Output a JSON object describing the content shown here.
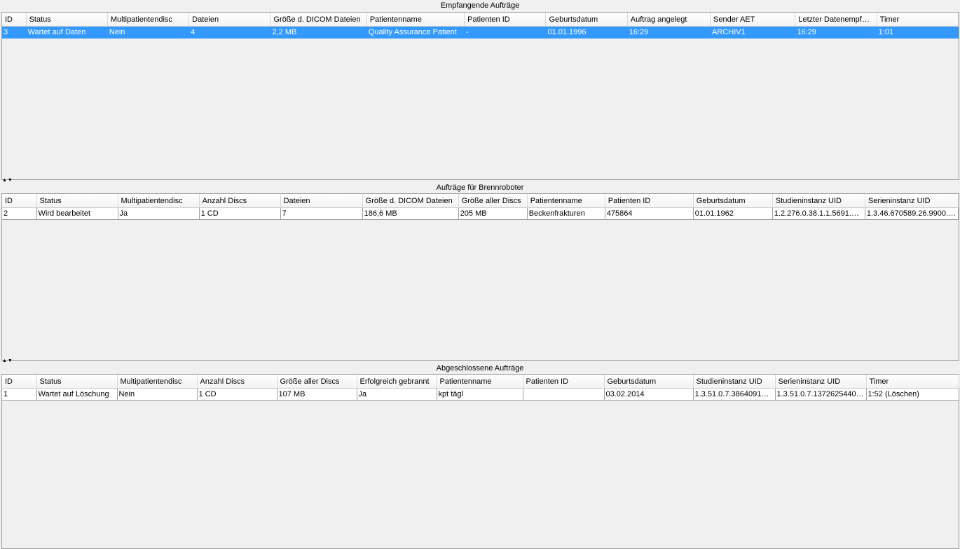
{
  "panels": [
    {
      "title": "Empfangende Aufträge",
      "columns": [
        "ID",
        "Status",
        "Multipatientendisc",
        "Dateien",
        "Größe d. DICOM Dateien",
        "Patientenname",
        "Patienten ID",
        "Geburtsdatum",
        "Auftrag angelegt",
        "Sender AET",
        "Letzter Datenempf…",
        "Timer"
      ],
      "rows": [
        [
          "3",
          "Wartet auf Daten",
          "Nein",
          "4",
          "2,2 MB",
          "Quality Assurance Patient",
          "-",
          "01.01.1996",
          "16:29",
          "ARCHIV1",
          "16:29",
          "1:01"
        ]
      ]
    },
    {
      "title": "Aufträge für Brennroboter",
      "columns": [
        "ID",
        "Status",
        "Multipatientendisc",
        "Anzahl Discs",
        "Dateien",
        "Größe d. DICOM Dateien",
        "Größe aller Discs",
        "Patientenname",
        "Patienten ID",
        "Geburtsdatum",
        "Studieninstanz UID",
        "Serieninstanz UID"
      ],
      "rows": [
        [
          "2",
          "Wird bearbeitet",
          "Ja",
          "1 CD",
          "7",
          "186,6 MB",
          "205 MB",
          "Beckenfrakturen",
          "475864",
          "01.01.1962",
          "1.2.276.0.38.1.1.5691.…",
          "1.3.46.670589.26.9900.…"
        ]
      ]
    },
    {
      "title": "Abgeschlossene Aufträge",
      "columns": [
        "ID",
        "Status",
        "Multipatientendisc",
        "Anzahl Discs",
        "Größe aller Discs",
        "Erfolgreich gebrannt",
        "Patientenname",
        "Patienten ID",
        "Geburtsdatum",
        "Studieninstanz UID",
        "Serieninstanz UID",
        "Timer"
      ],
      "rows": [
        [
          "1",
          "Wartet auf Löschung",
          "Nein",
          "1 CD",
          "107 MB",
          "Ja",
          "kpt tägl",
          "",
          "03.02.2014",
          "1.3.51.0.7.3864091…",
          "1.3.51.0.7.1372625440…",
          "1:52 (Löschen)"
        ]
      ]
    }
  ],
  "splitter_arrows": "▲▼",
  "colors": {
    "selection": "#3399ff",
    "background": "#f0f0f0"
  }
}
